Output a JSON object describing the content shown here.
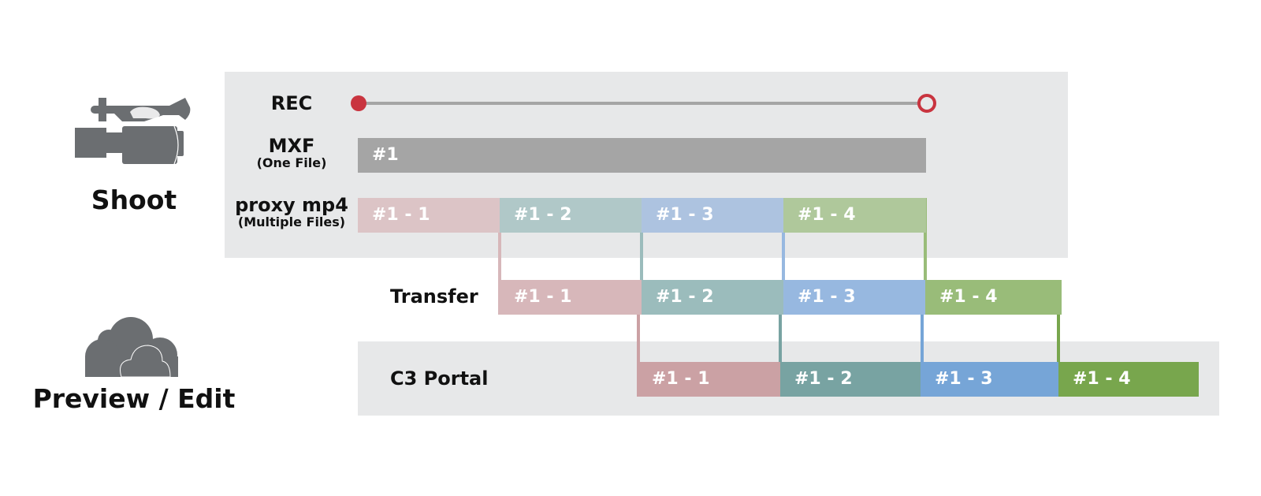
{
  "stages": {
    "shoot": {
      "title": "Shoot",
      "icon": "video-camera-icon"
    },
    "preview": {
      "title": "Preview / Edit",
      "icon": "cloud-icon"
    }
  },
  "rows": {
    "rec": {
      "label": "REC"
    },
    "mxf": {
      "label": "MXF",
      "sublabel": "(One File)",
      "bar": "#1"
    },
    "proxy": {
      "label": "proxy mp4",
      "sublabel": "(Multiple Files)",
      "segments": [
        "#1 - 1",
        "#1 - 2",
        "#1 - 3",
        "#1 - 4"
      ]
    },
    "transfer": {
      "label": "Transfer",
      "segments": [
        "#1 - 1",
        "#1 - 2",
        "#1 - 3",
        "#1 - 4"
      ]
    },
    "c3": {
      "label": "C3 Portal",
      "segments": [
        "#1 - 1",
        "#1 - 2",
        "#1 - 3",
        "#1 - 4"
      ]
    }
  },
  "colors": {
    "rec_red": "#c9343f",
    "mxf_gray": "#a5a5a5",
    "panel_gray": "#e7e8e9",
    "icon_gray": "#6b6e71",
    "proxy": [
      "#dcc4c6",
      "#b0c8c8",
      "#adc3e0",
      "#afc89b"
    ],
    "transfer": [
      "#d7b7ba",
      "#9bbcbc",
      "#97b8e0",
      "#99bc79"
    ],
    "c3": [
      "#cba1a4",
      "#78a3a2",
      "#76a5d7",
      "#78a64d"
    ]
  }
}
